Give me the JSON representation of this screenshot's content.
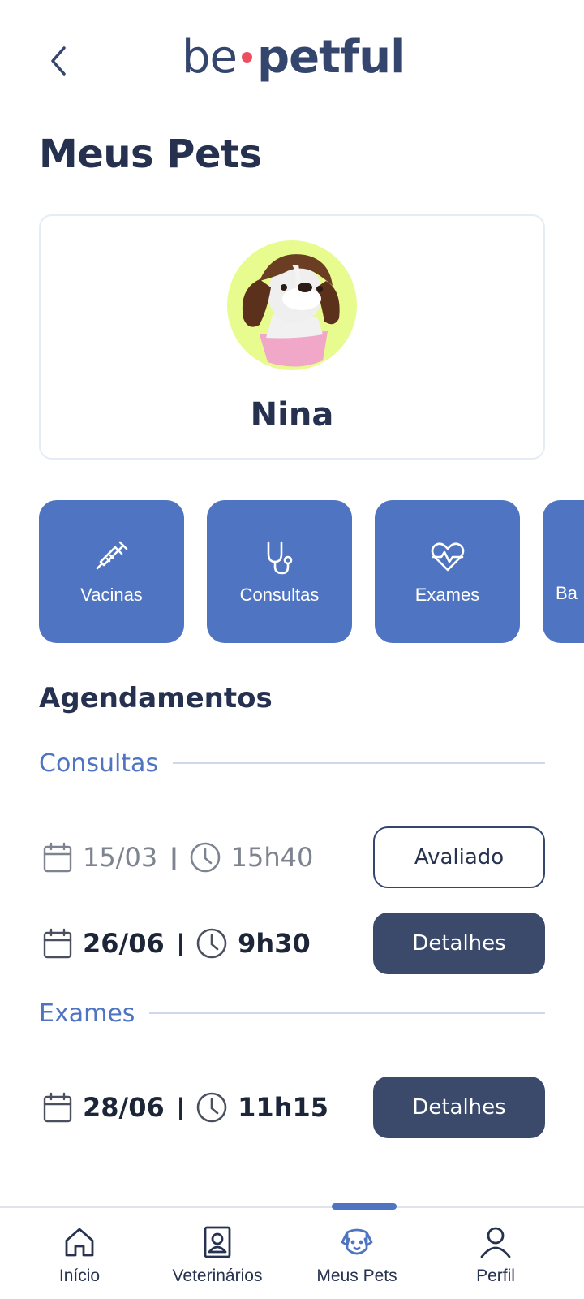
{
  "header": {
    "logo_prefix": "be",
    "logo_main": "petful"
  },
  "page_title": "Meus Pets",
  "pet": {
    "name": "Nina"
  },
  "categories": [
    {
      "label": "Vacinas",
      "icon": "syringe-icon"
    },
    {
      "label": "Consultas",
      "icon": "stethoscope-icon"
    },
    {
      "label": "Exames",
      "icon": "heart-pulse-icon"
    },
    {
      "label": "Ba",
      "icon": "partially-visible"
    }
  ],
  "appointments": {
    "title": "Agendamentos",
    "groups": [
      {
        "label": "Consultas",
        "items": [
          {
            "date": "15/03",
            "separator": "|",
            "time": "15h40",
            "button": "Avaliado",
            "state": "past"
          },
          {
            "date": "26/06",
            "separator": "|",
            "time": "9h30",
            "button": "Detalhes",
            "state": "upcoming"
          }
        ]
      },
      {
        "label": "Exames",
        "items": [
          {
            "date": "28/06",
            "separator": "|",
            "time": "11h15",
            "button": "Detalhes",
            "state": "upcoming"
          }
        ]
      }
    ]
  },
  "bottom_nav": [
    {
      "label": "Início",
      "icon": "home-icon"
    },
    {
      "label": "Veterinários",
      "icon": "id-badge-icon"
    },
    {
      "label": "Meus Pets",
      "icon": "dog-icon",
      "active": true
    },
    {
      "label": "Perfil",
      "icon": "user-icon"
    }
  ],
  "colors": {
    "primary": "#4f74c1",
    "navy": "#3b4a6b",
    "text": "#26324f",
    "accent_dot": "#ee4d5f",
    "avatar_bg": "#e7fb8e"
  }
}
